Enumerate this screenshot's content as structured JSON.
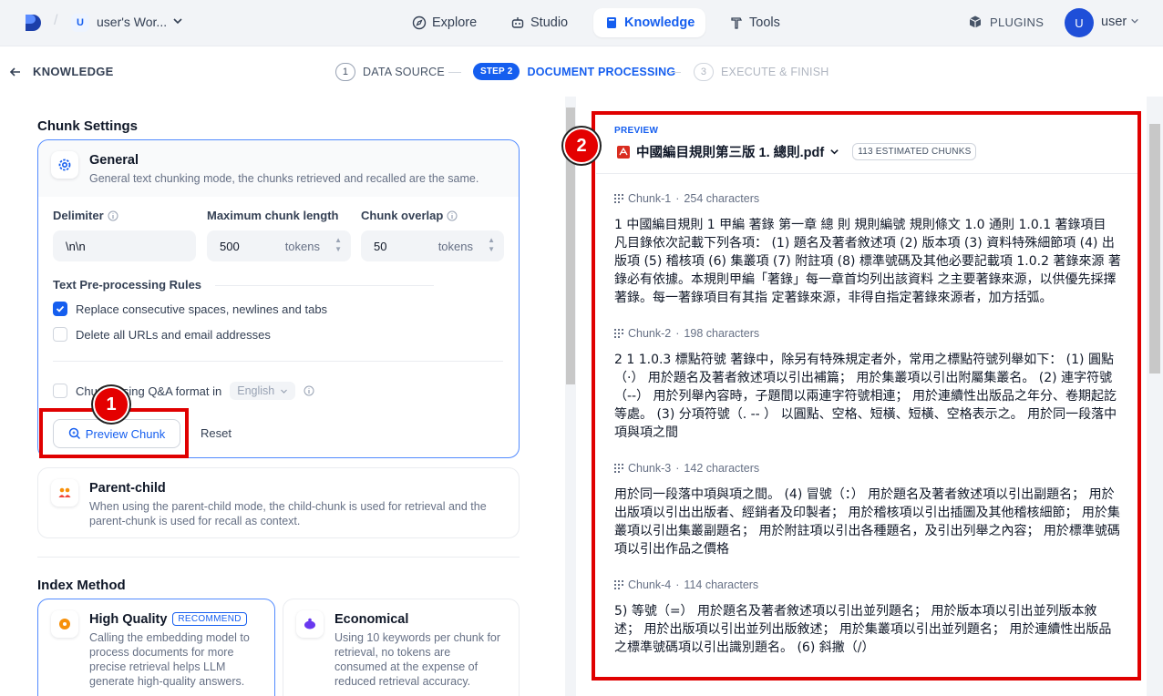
{
  "topnav": {
    "workspace_badge": "U",
    "workspace_name": "user's Wor...",
    "tabs": [
      {
        "label": "Explore",
        "icon": "compass-icon"
      },
      {
        "label": "Studio",
        "icon": "robot-icon"
      },
      {
        "label": "Knowledge",
        "icon": "book-icon",
        "active": true
      },
      {
        "label": "Tools",
        "icon": "hammer-icon"
      }
    ],
    "plugins_label": "PLUGINS",
    "avatar_initial": "U",
    "user_name": "user"
  },
  "stepbar": {
    "back_label": "KNOWLEDGE",
    "steps": [
      {
        "num": "1",
        "label": "DATA SOURCE"
      },
      {
        "num": "STEP 2",
        "label": "DOCUMENT PROCESSING"
      },
      {
        "num": "3",
        "label": "EXECUTE & FINISH"
      }
    ]
  },
  "chunk_settings": {
    "title": "Chunk Settings",
    "general": {
      "title": "General",
      "desc": "General text chunking mode, the chunks retrieved and recalled are the same."
    },
    "delimiter": {
      "label": "Delimiter",
      "value": "\\n\\n"
    },
    "max_length": {
      "label": "Maximum chunk length",
      "value": "500",
      "unit": "tokens"
    },
    "overlap": {
      "label": "Chunk overlap",
      "value": "50",
      "unit": "tokens"
    },
    "rules_title": "Text Pre-processing Rules",
    "rule_replace": "Replace consecutive spaces, newlines and tabs",
    "rule_delete": "Delete all URLs and email addresses",
    "qa_prefix": "Chu",
    "qa_suffix": "sing Q&A format in",
    "qa_language": "English",
    "preview_button": "Preview Chunk",
    "reset_button": "Reset",
    "parent_child": {
      "title": "Parent-child",
      "desc": "When using the parent-child mode, the child-chunk is used for retrieval and the parent-chunk is used for recall as context."
    }
  },
  "index_method": {
    "title": "Index Method",
    "high_quality": {
      "title": "High Quality",
      "badge": "RECOMMEND",
      "desc": "Calling the embedding model to process documents for more precise retrieval helps LLM generate high-quality answers."
    },
    "economical": {
      "title": "Economical",
      "desc": "Using 10 keywords per chunk for retrieval, no tokens are consumed at the expense of reduced retrieval accuracy."
    }
  },
  "preview": {
    "label": "PREVIEW",
    "file_name": "中國編目規則第三版 1. 總則.pdf",
    "chunk_count": "113 ESTIMATED CHUNKS",
    "chunks": [
      {
        "name": "Chunk-1",
        "chars": "254 characters",
        "text": "1 中國編目規則 1 甲編 著錄 第一章 總 則 規則編號 規則條文 1.0 通則 1.0.1 著錄項目 凡目錄依次記載下列各項： (1) 題名及著者敘述項 (2) 版本項 (3) 資料特殊細節項 (4) 出版項 (5) 稽核項 (6) 集叢項 (7) 附註項 (8) 標準號碼及其他必要記載項 1.0.2 著錄來源 著錄必有依據。本規則甲編「著錄」每一章首均列出該資料 之主要著錄來源，以供優先採擇著錄。每一著錄項目有其指 定著錄來源，非得自指定著錄來源者，加方括弧。"
      },
      {
        "name": "Chunk-2",
        "chars": "198 characters",
        "text": "2 1 1.0.3 標點符號 著錄中，除另有特殊規定者外，常用之標點符號列舉如下： (1) 圓點（·） 用於題名及著者敘述項以引出補篇； 用於集叢項以引出附屬集叢名。 (2) 連字符號（--） 用於列舉內容時，子題間以兩連字符號相連； 用於連續性出版品之年分、卷期起訖等處。 (3) 分項符號（. -- ） 以圓點、空格、短橫、短橫、空格表示之。 用於同一段落中項與項之間"
      },
      {
        "name": "Chunk-3",
        "chars": "142 characters",
        "text": "用於同一段落中項與項之間。 (4) 冒號（：） 用於題名及著者敘述項以引出副題名； 用於出版項以引出出版者、經銷者及印製者； 用於稽核項以引出插圖及其他稽核細節； 用於集叢項以引出集叢副題名； 用於附註項以引出各種題名，及引出列舉之內容； 用於標準號碼項以引出作品之價格"
      },
      {
        "name": "Chunk-4",
        "chars": "114 characters",
        "text": "5) 等號（=） 用於題名及著者敘述項以引出並列題名； 用於版本項以引出並列版本敘述； 用於出版項以引出並列出版敘述； 用於集叢項以引出並列題名； 用於連續性出版品之標準號碼項以引出識別題名。 (6) 斜撇（/）"
      }
    ]
  },
  "annotations": {
    "marker_1": "1",
    "marker_2": "2"
  }
}
